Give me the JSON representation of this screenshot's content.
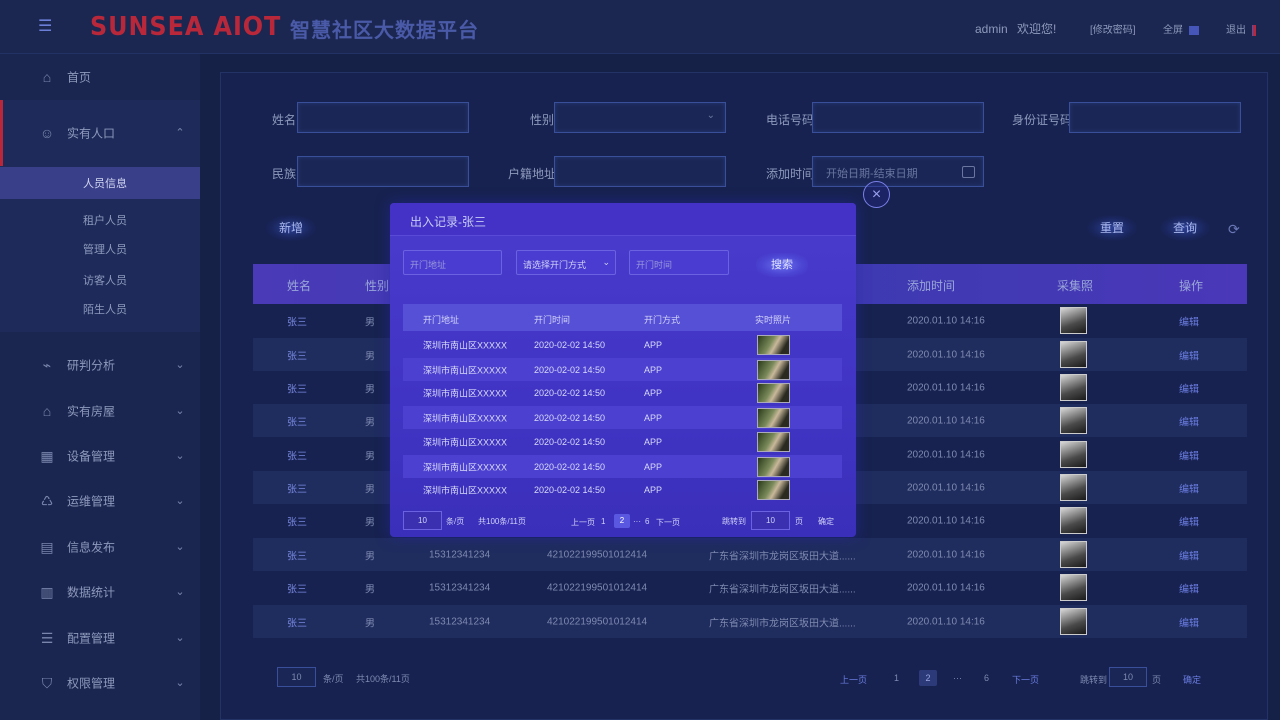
{
  "header": {
    "logo": "SUNSEA AIOT",
    "platform_title": "智慧社区大数据平台",
    "username": "admin",
    "welcome": "欢迎您!",
    "change_password": "[修改密码]",
    "fullscreen": "全屏",
    "logout": "退出"
  },
  "sidebar": {
    "home": "首页",
    "population": "实有人口",
    "sub_items": [
      "人员信息",
      "租户人员",
      "管理人员",
      "访客人员",
      "陌生人员"
    ],
    "analysis": "研判分析",
    "housing": "实有房屋",
    "devices": "设备管理",
    "ops": "运维管理",
    "publish": "信息发布",
    "stats": "数据统计",
    "config": "配置管理",
    "permissions": "权限管理"
  },
  "filters": {
    "name_label": "姓名",
    "gender_label": "性别",
    "phone_label": "电话号码",
    "id_label": "身份证号码",
    "ethnicity_label": "民族",
    "address_label": "户籍地址",
    "added_time_label": "添加时间",
    "date_placeholder": "开始日期-结束日期"
  },
  "actions": {
    "add": "新增",
    "reset": "重置",
    "query": "查询"
  },
  "table": {
    "headers": [
      "姓名",
      "性别",
      "添加时间",
      "采集照",
      "操作"
    ],
    "rows": [
      {
        "name": "张三",
        "gender": "男",
        "phone": "",
        "id": "",
        "address": "",
        "time": "2020.01.10 14:16",
        "action": "编辑"
      },
      {
        "name": "张三",
        "gender": "男",
        "phone": "",
        "id": "",
        "address": "",
        "time": "2020.01.10 14:16",
        "action": "编辑"
      },
      {
        "name": "张三",
        "gender": "男",
        "phone": "",
        "id": "",
        "address": "",
        "time": "2020.01.10 14:16",
        "action": "编辑"
      },
      {
        "name": "张三",
        "gender": "男",
        "phone": "",
        "id": "",
        "address": "",
        "time": "2020.01.10 14:16",
        "action": "编辑"
      },
      {
        "name": "张三",
        "gender": "男",
        "phone": "",
        "id": "",
        "address": "",
        "time": "2020.01.10 14:16",
        "action": "编辑"
      },
      {
        "name": "张三",
        "gender": "男",
        "phone": "",
        "id": "",
        "address": "",
        "time": "2020.01.10 14:16",
        "action": "编辑"
      },
      {
        "name": "张三",
        "gender": "男",
        "phone": "",
        "id": "",
        "address": "",
        "time": "2020.01.10 14:16",
        "action": "编辑"
      },
      {
        "name": "张三",
        "gender": "男",
        "phone": "15312341234",
        "id": "421022199501012414",
        "address": "广东省深圳市龙岗区坂田大道......",
        "time": "2020.01.10 14:16",
        "action": "编辑"
      },
      {
        "name": "张三",
        "gender": "男",
        "phone": "15312341234",
        "id": "421022199501012414",
        "address": "广东省深圳市龙岗区坂田大道......",
        "time": "2020.01.10 14:16",
        "action": "编辑"
      },
      {
        "name": "张三",
        "gender": "男",
        "phone": "15312341234",
        "id": "421022199501012414",
        "address": "广东省深圳市龙岗区坂田大道......",
        "time": "2020.01.10 14:16",
        "action": "编辑"
      }
    ]
  },
  "pagination": {
    "page_size": "10",
    "per_page": "条/页",
    "total": "共100条/11页",
    "prev": "上一页",
    "pages": [
      "1",
      "2",
      "···",
      "6"
    ],
    "next": "下一页",
    "jump_to": "跳转到",
    "jump_value": "10",
    "page_unit": "页",
    "confirm": "确定"
  },
  "modal": {
    "title": "出入记录-张三",
    "address_placeholder": "开门地址",
    "method_select": "请选择开门方式",
    "time_placeholder": "开门时间",
    "search": "搜索",
    "headers": [
      "开门地址",
      "开门时间",
      "开门方式",
      "实时照片"
    ],
    "rows": [
      {
        "address": "深圳市南山区XXXXX",
        "time": "2020-02-02 14:50",
        "method": "APP"
      },
      {
        "address": "深圳市南山区XXXXX",
        "time": "2020-02-02 14:50",
        "method": "APP"
      },
      {
        "address": "深圳市南山区XXXXX",
        "time": "2020-02-02 14:50",
        "method": "APP"
      },
      {
        "address": "深圳市南山区XXXXX",
        "time": "2020-02-02 14:50",
        "method": "APP"
      },
      {
        "address": "深圳市南山区XXXXX",
        "time": "2020-02-02 14:50",
        "method": "APP"
      },
      {
        "address": "深圳市南山区XXXXX",
        "time": "2020-02-02 14:50",
        "method": "APP"
      },
      {
        "address": "深圳市南山区XXXXX",
        "time": "2020-02-02 14:50",
        "method": "APP"
      }
    ],
    "pagination": {
      "page_size": "10",
      "per_page": "条/页",
      "total": "共100条/11页",
      "prev": "上一页",
      "pages": [
        "1",
        "2",
        "···",
        "6"
      ],
      "next": "下一页",
      "jump_to": "跳转到",
      "jump_value": "10",
      "page_unit": "页",
      "confirm": "确定"
    }
  },
  "colors": {
    "accent": "#b8283a",
    "primary": "#4a3ccc",
    "background": "#162148"
  }
}
